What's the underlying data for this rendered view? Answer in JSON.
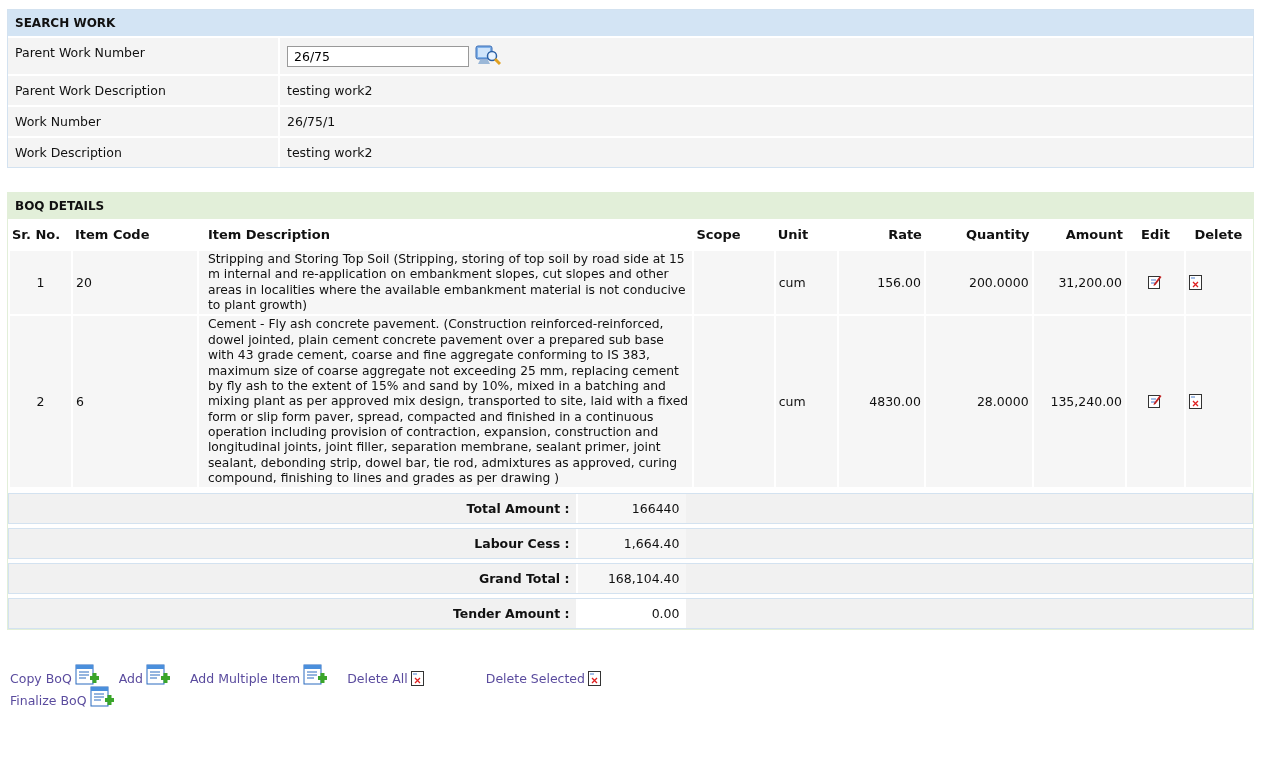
{
  "search_work": {
    "title": "SEARCH WORK",
    "fields": [
      {
        "label": "Parent Work Number",
        "kind": "input",
        "value": "26/75"
      },
      {
        "label": "Parent Work Description",
        "kind": "text",
        "value": "testing work2"
      },
      {
        "label": "Work Number",
        "kind": "text",
        "value": "26/75/1"
      },
      {
        "label": "Work Description",
        "kind": "text",
        "value": "testing work2"
      }
    ]
  },
  "boq_details": {
    "title": "BOQ DETAILS",
    "columns": [
      "Sr. No.",
      "Item Code",
      "Item Description",
      "Scope",
      "Unit",
      "Rate",
      "Quantity",
      "Amount",
      "Edit",
      "Delete"
    ],
    "rows": [
      {
        "sr_no": "1",
        "item_code": "20",
        "description": "Stripping and Storing Top Soil (Stripping, storing of top soil by road side at 15 m internal and re-application on embankment slopes, cut slopes and other areas in localities where the available embankment material is not conducive to plant growth)",
        "unit": "cum",
        "rate": "156.00",
        "quantity": "200.0000",
        "amount": "31,200.00"
      },
      {
        "sr_no": "2",
        "item_code": "6",
        "description": "Cement - Fly ash concrete pavement. (Construction reinforced-reinforced, dowel jointed, plain cement concrete pavement over a prepared sub base with 43 grade cement, coarse and fine aggregate conforming to IS 383, maximum size of coarse aggregate not exceeding 25 mm, replacing cement by fly ash to the extent of 15% and sand by 10%, mixed in a batching and mixing plant as per approved mix design, transported to site, laid with a fixed form or slip form paver, spread, compacted and finished in a continuous operation including provision of contraction, expansion, construction and longitudinal joints, joint filler, separation membrane, sealant primer, joint sealant, debonding strip, dowel bar, tie rod, admixtures as approved, curing compound, finishing to lines and grades as per drawing )",
        "unit": "cum",
        "rate": "4830.00",
        "quantity": "28.0000",
        "amount": "135,240.00"
      }
    ],
    "totals": [
      {
        "label": "Total Amount :",
        "value": "166440"
      },
      {
        "label": "Labour Cess :",
        "value": "1,664.40"
      },
      {
        "label": "Grand Total :",
        "value": "168,104.40"
      },
      {
        "label": "Tender Amount :",
        "value": "0.00"
      }
    ]
  },
  "actions": [
    {
      "label": "Copy BoQ",
      "kind": "add"
    },
    {
      "label": "Add",
      "kind": "add"
    },
    {
      "label": "Add Multiple Item",
      "kind": "add"
    },
    {
      "label": "Delete All",
      "kind": "delete"
    },
    {
      "label": "Delete Selected",
      "kind": "delete"
    },
    {
      "label": "Finalize BoQ",
      "kind": "add"
    }
  ]
}
